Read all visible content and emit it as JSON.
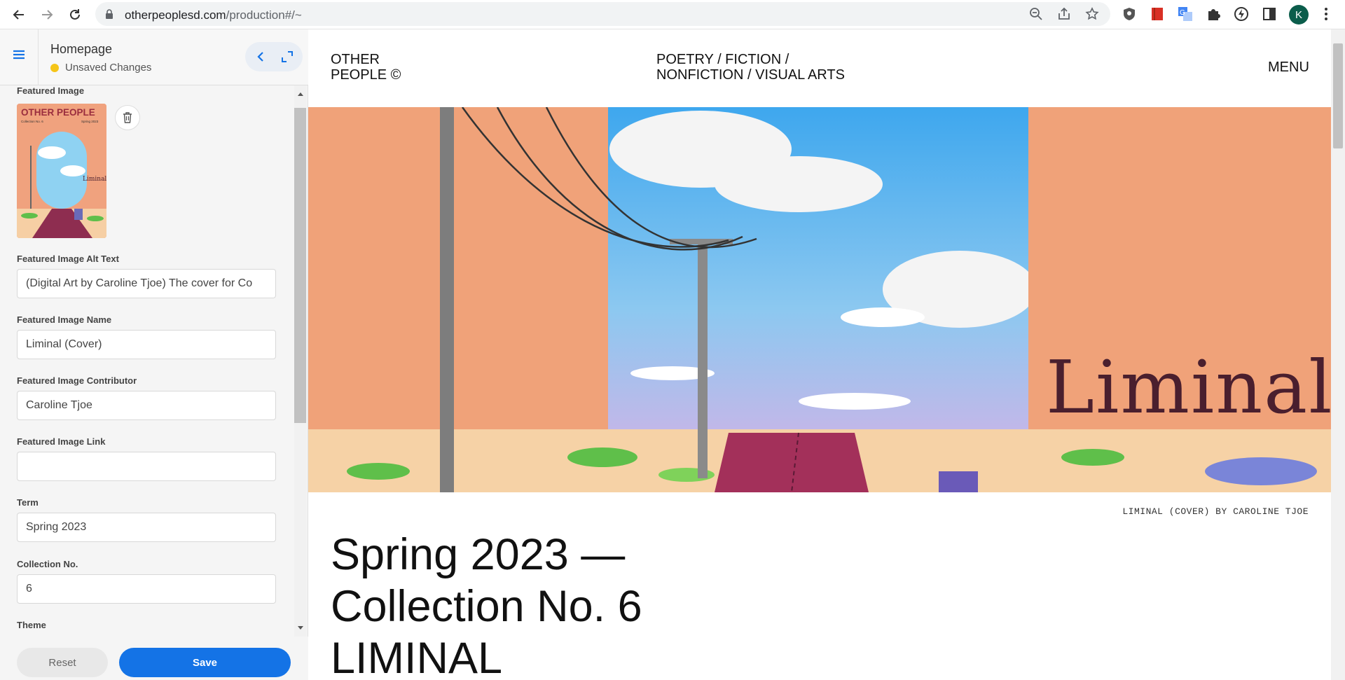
{
  "browser": {
    "url_host": "otherpeoplesd.com",
    "url_path": "/production#/~",
    "profile_initial": "K"
  },
  "editor": {
    "page_title": "Homepage",
    "status": "Unsaved Changes",
    "status_color": "#f5c518",
    "fields": {
      "featured_image_label": "Featured Image",
      "alt_text_label": "Featured Image Alt Text",
      "alt_text_value": "(Digital Art by Caroline Tjoe) The cover for Co",
      "name_label": "Featured Image Name",
      "name_value": "Liminal (Cover)",
      "contributor_label": "Featured Image Contributor",
      "contributor_value": "Caroline Tjoe",
      "link_label": "Featured Image Link",
      "link_value": "",
      "term_label": "Term",
      "term_value": "Spring 2023",
      "collection_label": "Collection No.",
      "collection_value": "6",
      "theme_label": "Theme"
    },
    "thumbnail": {
      "title": "OTHER PEOPLE",
      "sub_left": "Collection No. 6",
      "sub_right": "Spring 2023",
      "word": "Liminal"
    },
    "reset_label": "Reset",
    "save_label": "Save",
    "accent": "#1473e6"
  },
  "site": {
    "logo_line1": "OTHER",
    "logo_line2": "PEOPLE ©",
    "cats_line1": "POETRY / FICTION /",
    "cats_line2": "NONFICTION / VISUAL ARTS",
    "menu": "MENU",
    "hero_word": "Liminal",
    "caption": "LIMINAL (COVER) BY CAROLINE TJOE",
    "headline_line1": "Spring 2023 —",
    "headline_line2": "Collection No. 6",
    "headline_line3": "LIMINAL"
  }
}
